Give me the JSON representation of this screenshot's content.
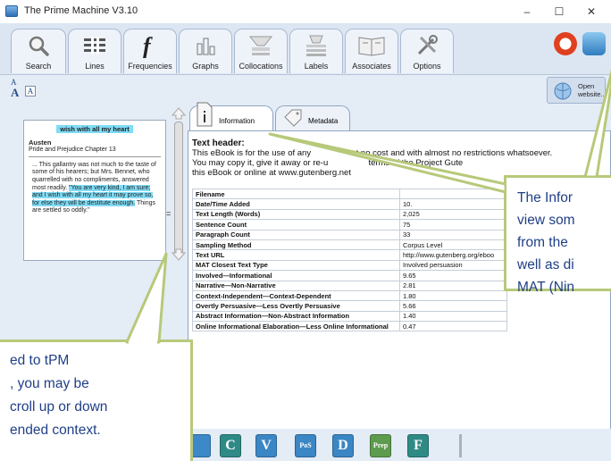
{
  "window": {
    "title": "The Prime Machine V3.10",
    "controls": {
      "minimize": "–",
      "maximize": "☐",
      "close": "✕"
    }
  },
  "toolbar": {
    "buttons": [
      {
        "label": "Search",
        "icon": "magnifier-icon"
      },
      {
        "label": "Lines",
        "icon": "lines-icon"
      },
      {
        "label": "Frequencies",
        "icon": "function-f-icon"
      },
      {
        "label": "Graphs",
        "icon": "bar-graph-icon"
      },
      {
        "label": "Collocations",
        "icon": "collocations-icon"
      },
      {
        "label": "Labels",
        "icon": "labels-icon"
      },
      {
        "label": "Associates",
        "icon": "book-icon"
      },
      {
        "label": "Options",
        "icon": "tools-icon"
      }
    ]
  },
  "font_size": {
    "large": "A",
    "small": "A",
    "toggle": "A"
  },
  "open_website": {
    "label_line1": "Open",
    "label_line2": "website..."
  },
  "concordance": {
    "heading": "wish with all my heart",
    "book_title": "Austen",
    "book_subtitle": "Pride and Prejudice Chapter 13",
    "body_pre": "... This gallantry was not much to the taste of some of his hearers; but Mrs. Bennet, who quarrelled with no compliments, answered most readily.",
    "body_highlight": "\"You are very kind, I am sure; and I wish with all my heart it may prove so, for else they will be destitute enough.",
    "body_post": " Things are settled so oddly.\"",
    "equals_marker": "="
  },
  "tabs": [
    {
      "label": "Information",
      "active": true
    },
    {
      "label": "Metadata",
      "active": false
    }
  ],
  "info": {
    "header_title": "Text header:",
    "header_line1_a": "This eBook is for the use of any",
    "header_line1_b": "at no cost and with almost no restrictions whatsoever.",
    "header_line2_a": "You may copy it, give it away or re-u",
    "header_line2_b": "terms of the Project Gute",
    "header_line3": "this eBook or online at www.gutenberg.net",
    "rows": [
      {
        "key": "Filename",
        "value": ""
      },
      {
        "key": "Date/Time Added",
        "value": "10."
      },
      {
        "key": "Text Length (Words)",
        "value": "2,025"
      },
      {
        "key": "Sentence Count",
        "value": "75"
      },
      {
        "key": "Paragraph Count",
        "value": "33"
      },
      {
        "key": "Sampling Method",
        "value": "Corpus Level"
      },
      {
        "key": "Text URL",
        "value": "http://www.gutenberg.org/eboo"
      },
      {
        "key": "MAT Closest Text Type",
        "value": "Involved persuasion"
      },
      {
        "key": "Involved—Informational",
        "value": "9.65"
      },
      {
        "key": "Narrative—Non-Narrative",
        "value": "2.81"
      },
      {
        "key": "Context-Independent—Context-Dependent",
        "value": "1.80"
      },
      {
        "key": "Overtly Persuasive—Less Overtly Persuasive",
        "value": "5.66"
      },
      {
        "key": "Abstract Information—Non-Abstract Information",
        "value": "1.40"
      },
      {
        "key": "Online Informational Elaboration—Less Online Informational",
        "value": "0.47"
      }
    ]
  },
  "bottom_icons": [
    {
      "letter": "",
      "color": "#3d88c9"
    },
    {
      "letter": "C",
      "color": "#2f8a86"
    },
    {
      "letter": "V",
      "color": "#3b86c4"
    },
    {
      "letter": "PoS",
      "color": "#3b86c4"
    },
    {
      "letter": "D",
      "color": "#3b86c4"
    },
    {
      "letter": "Prep",
      "color": "#5d9b4e"
    },
    {
      "letter": "F",
      "color": "#2f8a86"
    }
  ],
  "callouts": {
    "left_lines": [
      "ed to tPM",
      ", you may be",
      "croll up or down",
      "ended context."
    ],
    "right_lines": [
      "The Infor",
      "view som",
      "from the",
      "well as di",
      "MAT (Nin"
    ]
  }
}
